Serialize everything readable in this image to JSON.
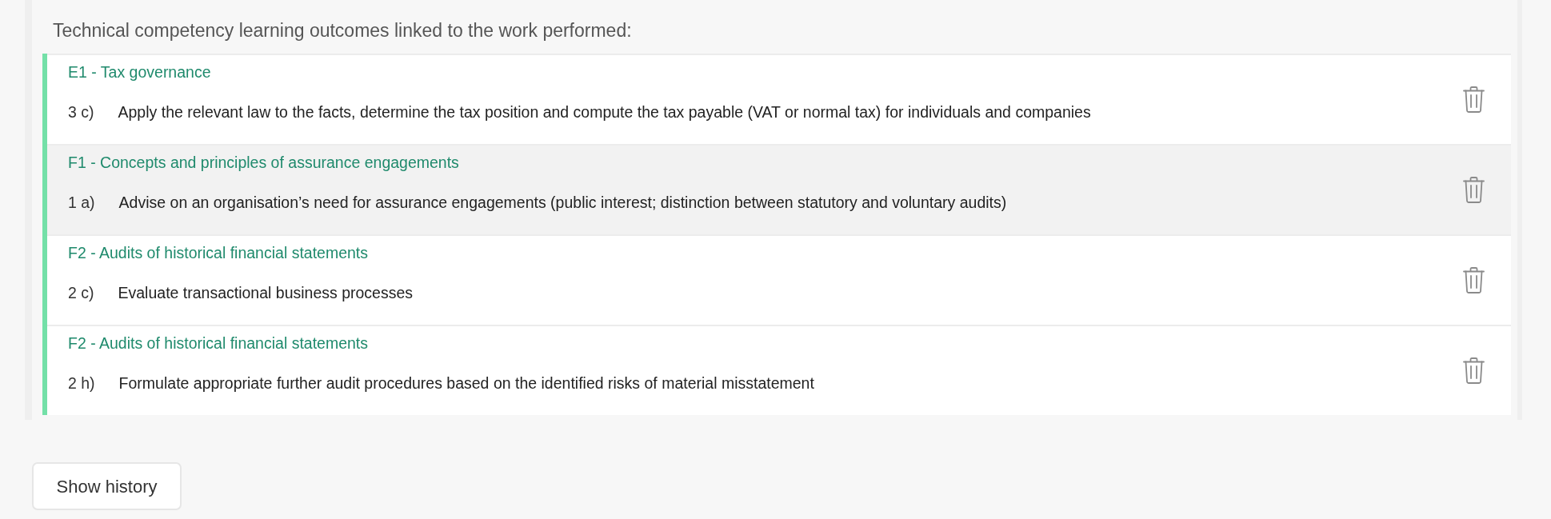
{
  "heading": "Technical competency learning outcomes linked to the work performed:",
  "outcomes": [
    {
      "title": "E1 - Tax governance",
      "number": "3 c)",
      "text": "Apply the relevant law to the facts, determine the tax position and compute the tax payable (VAT or normal tax) for individuals and companies",
      "hovered": false
    },
    {
      "title": "F1 - Concepts and principles of assurance engagements",
      "number": "1 a)",
      "text": "Advise on an organisation’s need for assurance engagements (public interest; distinction between statutory and voluntary audits)",
      "hovered": true
    },
    {
      "title": "F2 - Audits of historical financial statements",
      "number": "2 c)",
      "text": "Evaluate transactional business processes",
      "hovered": false
    },
    {
      "title": "F2 - Audits of historical financial statements",
      "number": "2 h)",
      "text": "Formulate appropriate further audit procedures based on the identified risks of material misstatement",
      "hovered": false
    }
  ],
  "show_history_button": {
    "label": "Show history"
  }
}
